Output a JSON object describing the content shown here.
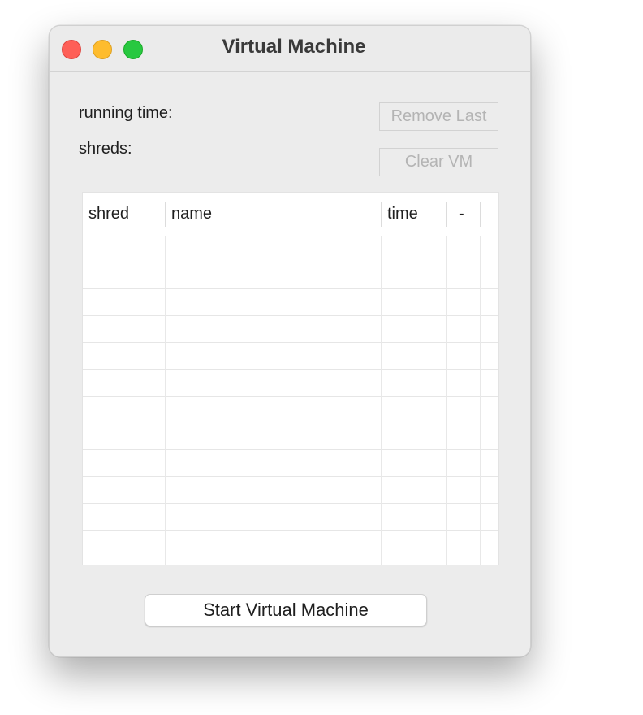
{
  "window": {
    "title": "Virtual Machine"
  },
  "status": {
    "running_time_label": "running time:",
    "shreds_label": "shreds:"
  },
  "buttons": {
    "remove_last": "Remove Last",
    "clear_vm": "Clear VM",
    "start_vm": "Start Virtual Machine"
  },
  "table": {
    "columns": [
      {
        "label": "shred"
      },
      {
        "label": "name"
      },
      {
        "label": "time"
      },
      {
        "label": "-"
      }
    ],
    "rows": []
  },
  "colors": {
    "close": "#fe5f57",
    "minimize": "#febc2e",
    "zoom": "#28c840",
    "window_bg": "#ececec",
    "disabled_text": "#b4b4b4"
  },
  "icons": [
    "close-icon",
    "minimize-icon",
    "zoom-icon"
  ]
}
